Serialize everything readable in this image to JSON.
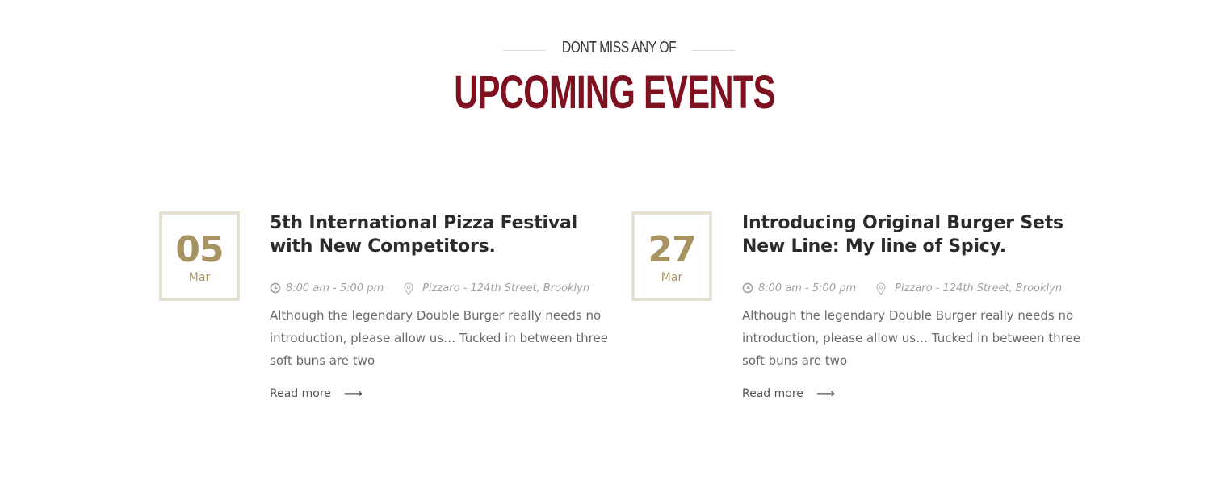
{
  "section": {
    "subtitle": "DONT MISS ANY OF",
    "title": "UPCOMING EVENTS"
  },
  "events": [
    {
      "day": "05",
      "month": "Mar",
      "title": "5th International Pizza Festival with New Competitors.",
      "time": "8:00 am - 5:00 pm",
      "location": "Pizzaro - 124th Street, Brooklyn",
      "description": "Although the legendary Double Burger really needs no introduction, please allow us… Tucked in between three soft buns are two",
      "read_more": "Read more",
      "arrow": "⟶"
    },
    {
      "day": "27",
      "month": "Mar",
      "title": "Introducing Original Burger Sets New Line: My line of Spicy.",
      "time": "8:00 am - 5:00 pm",
      "location": "Pizzaro - 124th Street, Brooklyn",
      "description": "Although the legendary Double Burger really needs no introduction, please allow us… Tucked in between three soft buns are two",
      "read_more": "Read more",
      "arrow": "⟶"
    }
  ],
  "icons": {
    "clock": "clock-icon",
    "location": "map-pin-icon",
    "arrow": "arrow-right-icon"
  },
  "colors": {
    "title": "#7e1020",
    "date_accent": "#a89363",
    "date_border": "#e7e1d4",
    "meta_text": "#a0a0a0",
    "body_text": "#6a6a6a"
  }
}
